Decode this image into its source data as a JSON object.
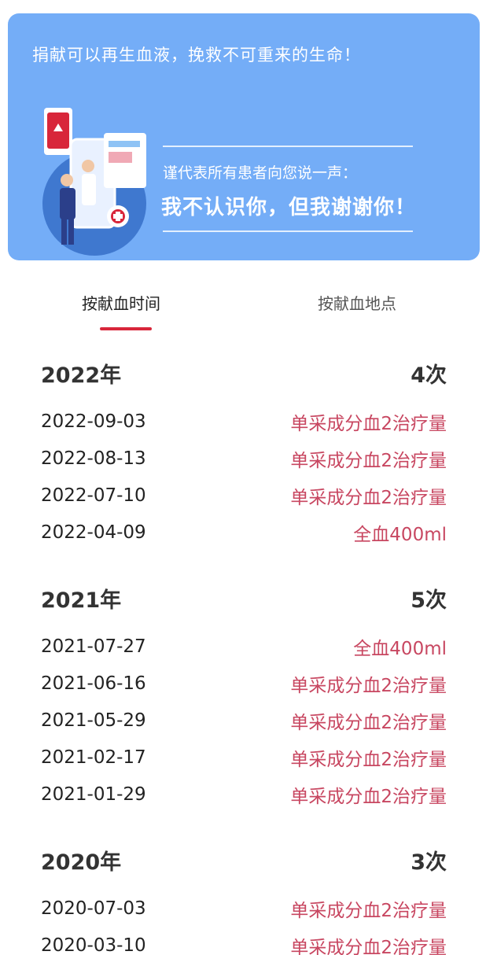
{
  "banner": {
    "slogan": "捐献可以再生血液，挽救不可重来的生命！",
    "thanks_sub": "谨代表所有患者向您说一声：",
    "thanks_main": "我不认识你，但我谢谢你！"
  },
  "tabs": [
    {
      "label": "按献血时间"
    },
    {
      "label": "按献血地点"
    }
  ],
  "colors": {
    "banner": "#74adf7",
    "accent": "#d8263a",
    "record_type": "#c84761"
  },
  "years": [
    {
      "year": "2022年",
      "count": "4次",
      "records": [
        {
          "date": "2022-09-03",
          "type": "单采成分血2治疗量"
        },
        {
          "date": "2022-08-13",
          "type": "单采成分血2治疗量"
        },
        {
          "date": "2022-07-10",
          "type": "单采成分血2治疗量"
        },
        {
          "date": "2022-04-09",
          "type": "全血400ml"
        }
      ]
    },
    {
      "year": "2021年",
      "count": "5次",
      "records": [
        {
          "date": "2021-07-27",
          "type": "全血400ml"
        },
        {
          "date": "2021-06-16",
          "type": "单采成分血2治疗量"
        },
        {
          "date": "2021-05-29",
          "type": "单采成分血2治疗量"
        },
        {
          "date": "2021-02-17",
          "type": "单采成分血2治疗量"
        },
        {
          "date": "2021-01-29",
          "type": "单采成分血2治疗量"
        }
      ]
    },
    {
      "year": "2020年",
      "count": "3次",
      "records": [
        {
          "date": "2020-07-03",
          "type": "单采成分血2治疗量"
        },
        {
          "date": "2020-03-10",
          "type": "单采成分血2治疗量"
        }
      ]
    }
  ]
}
